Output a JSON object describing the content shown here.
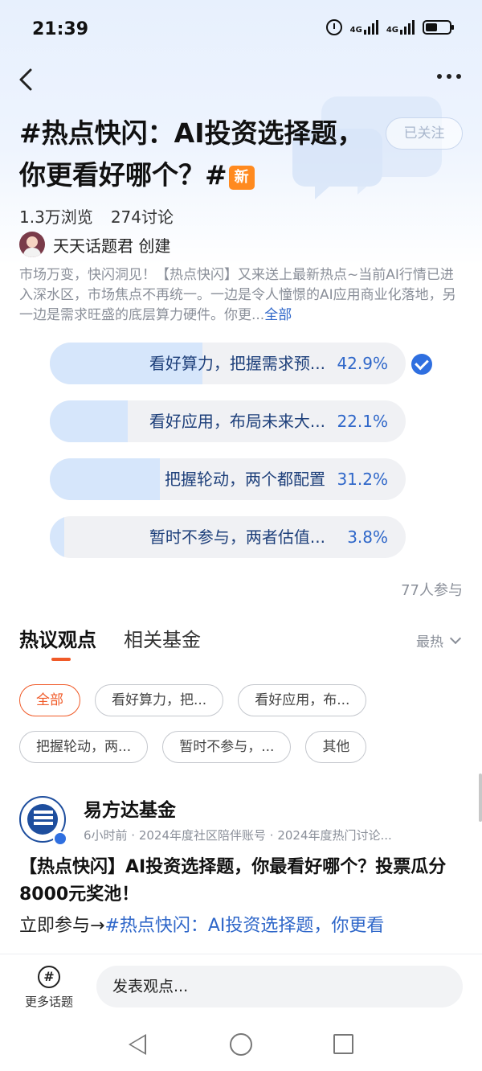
{
  "status_bar": {
    "time": "21:39",
    "network1": "4G",
    "network2": "4G"
  },
  "topic": {
    "title": "#热点快闪：AI投资选择题，你更看好哪个？#",
    "badge": "新",
    "follow_label": "已关注",
    "views": "1.3万浏览",
    "discussions": "274讨论",
    "creator": "天天话题君 创建",
    "description": "市场万变，快闪洞见！【热点快闪】又来送上最新热点~当前AI行情已进入深水区，市场焦点不再统一。一边是令人憧憬的AI应用商业化落地，另一边是需求旺盛的底层算力硬件。你更...",
    "description_more": "全部"
  },
  "poll": {
    "options": [
      {
        "label": "看好算力，把握需求预...",
        "percent": "42.9%",
        "fraction": 0.429,
        "selected": true
      },
      {
        "label": "看好应用，布局未来大...",
        "percent": "22.1%",
        "fraction": 0.221,
        "selected": false
      },
      {
        "label": "把握轮动，两个都配置",
        "percent": "31.2%",
        "fraction": 0.312,
        "selected": false
      },
      {
        "label": "暂时不参与，两者估值...",
        "percent": "3.8%",
        "fraction": 0.038,
        "selected": false
      }
    ],
    "participants": "77人参与"
  },
  "tabs": {
    "hot_views": "热议观点",
    "related_funds": "相关基金",
    "sort": "最热"
  },
  "filters": [
    [
      "全部",
      "看好算力，把...",
      "看好应用，布..."
    ],
    [
      "把握轮动，两...",
      "暂时不参与，...",
      "其他"
    ]
  ],
  "post": {
    "author": "易方达基金",
    "meta": "6小时前 · 2024年度社区陪伴账号 · 2024年度热门讨论...",
    "title": "【热点快闪】AI投资选择题，你最看好哪个？投票瓜分8000元奖池！",
    "body_prefix": "立即参与→",
    "body_link": "#热点快闪：AI投资选择题，你更看"
  },
  "bottom": {
    "more_topics": "更多话题",
    "comment_placeholder": "发表观点..."
  }
}
